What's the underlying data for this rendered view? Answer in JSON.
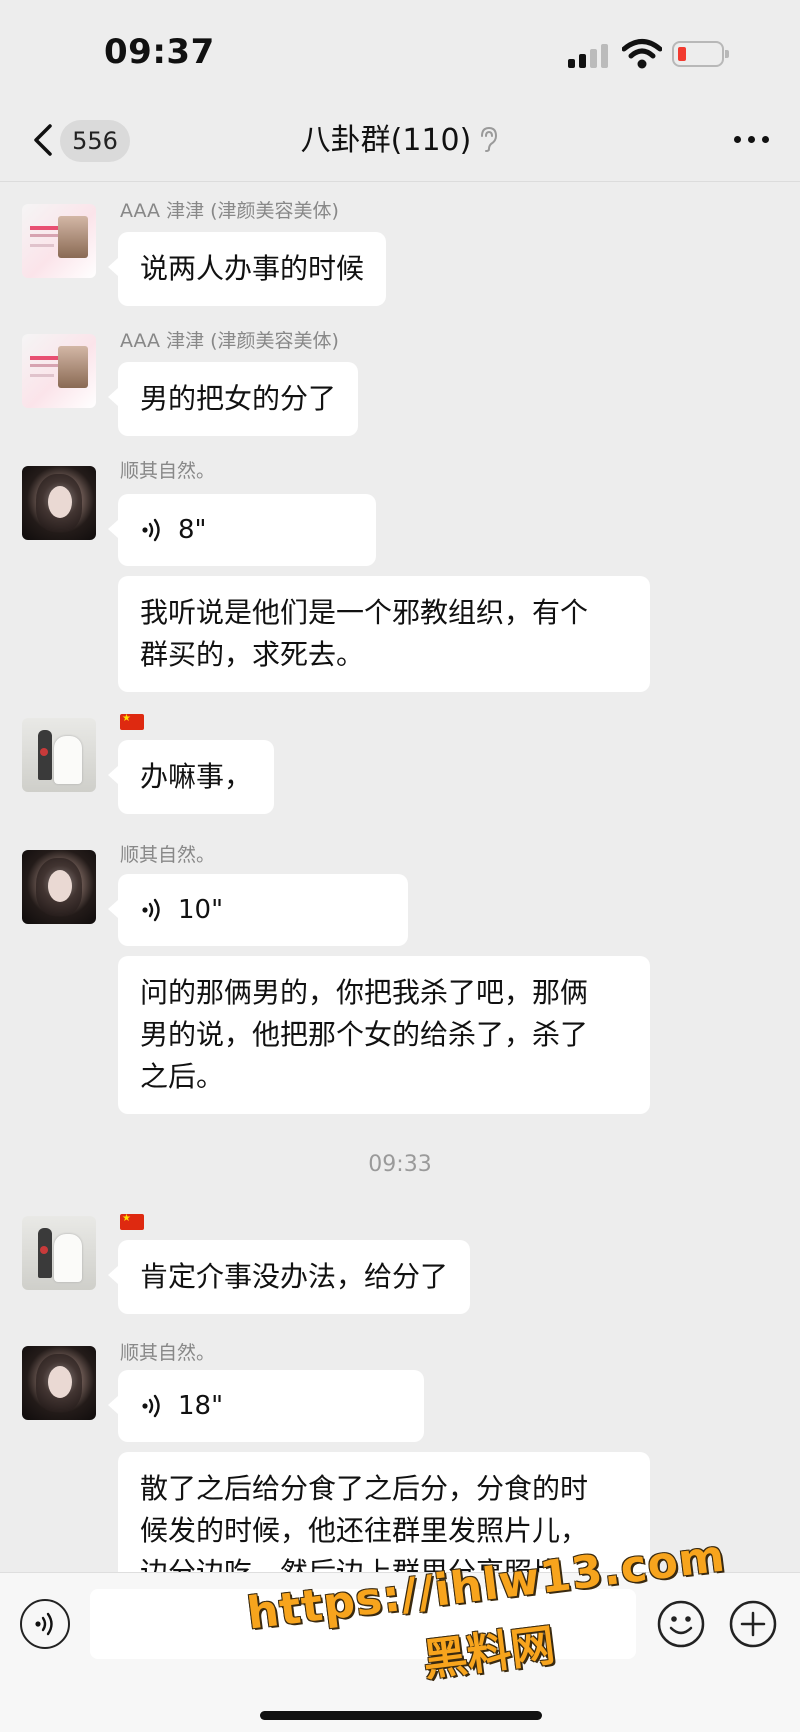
{
  "status_bar": {
    "time": "09:37"
  },
  "nav": {
    "unread_count": "556",
    "title": "八卦群(110)"
  },
  "colors": {
    "bubble": "#ffffff",
    "background": "#ededed",
    "battery_low": "#f23b30",
    "watermark": "#f7a41d"
  },
  "messages": [
    {
      "sender": "AAA 津津 (津颜美容美体)",
      "text": "说两人办事的时候"
    },
    {
      "sender": "AAA 津津 (津颜美容美体)",
      "text": "男的把女的分了"
    },
    {
      "sender": "顺其自然。",
      "voice": "8\"",
      "line1": "我听说是他们是一个邪教组织，有个",
      "line2": "群买的，求死去。"
    },
    {
      "sender_icon": "china-flag-icon",
      "text": "办嘛事，"
    },
    {
      "sender": "顺其自然。",
      "voice": "10\"",
      "line1": "问的那俩男的，你把我杀了吧，那俩",
      "line2": "男的说，他把那个女的给杀了，杀了",
      "line3": "之后。"
    },
    {
      "sender_icon": "china-flag-icon",
      "text": "肯定介事没办法，给分了"
    },
    {
      "sender": "顺其自然。",
      "voice": "18\"",
      "line1": "散了之后给分食了之后分，分食的时",
      "line2": "候发的时候，他还往群里发照片儿，",
      "line3": "边分边吃，然后边上群里分享照片"
    }
  ],
  "timestamp": "09:33",
  "watermark": {
    "url": "https://ihlw13.com",
    "name": "黑料网"
  }
}
